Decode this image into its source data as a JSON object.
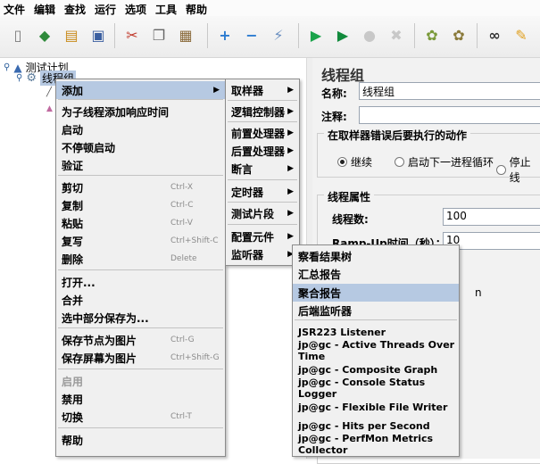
{
  "menubar": [
    "文件",
    "编辑",
    "查找",
    "运行",
    "选项",
    "工具",
    "帮助"
  ],
  "toolbar": {
    "icons": [
      {
        "name": "new-icon",
        "glyph": "▯",
        "color": "#7a7a7a"
      },
      {
        "name": "templates-icon",
        "glyph": "◆",
        "color": "#2f8a3b"
      },
      {
        "name": "open-icon",
        "glyph": "▤",
        "color": "#c88a1a"
      },
      {
        "name": "save-icon",
        "glyph": "▣",
        "color": "#3b5fa0"
      },
      {
        "name": "cut-icon",
        "glyph": "✂",
        "color": "#c0392b"
      },
      {
        "name": "copy-icon",
        "glyph": "❐",
        "color": "#666666"
      },
      {
        "name": "paste-icon",
        "glyph": "▦",
        "color": "#8a6a3a"
      },
      {
        "name": "expand-icon",
        "glyph": "+",
        "color": "#2b7bd0"
      },
      {
        "name": "collapse-icon",
        "glyph": "−",
        "color": "#2b7bd0"
      },
      {
        "name": "toggle-icon",
        "glyph": "⚡",
        "color": "#6a8fc0"
      },
      {
        "name": "start-icon",
        "glyph": "▶",
        "color": "#1aa34a"
      },
      {
        "name": "start-no-pauses-icon",
        "glyph": "▶",
        "color": "#118a3c"
      },
      {
        "name": "stop-icon",
        "glyph": "●",
        "color": "#c8c8c8"
      },
      {
        "name": "shutdown-icon",
        "glyph": "✖",
        "color": "#c8c8c8"
      },
      {
        "name": "clear-icon",
        "glyph": "✿",
        "color": "#7a9a3a"
      },
      {
        "name": "clear-all-icon",
        "glyph": "✿",
        "color": "#8a7a3a"
      },
      {
        "name": "search-icon",
        "glyph": "∞",
        "color": "#333333"
      },
      {
        "name": "reset-search-icon",
        "glyph": "✎",
        "color": "#e0a020"
      }
    ]
  },
  "tree": {
    "root": "测试计划",
    "thread_group": "线程组"
  },
  "panel": {
    "title": "线程组",
    "name_label": "名称:",
    "name_value": "线程组",
    "comment_label": "注释:",
    "comment_value": "",
    "error_group_title": "在取样器错误后要执行的动作",
    "radio_continue": "继续",
    "radio_next_loop": "启动下一进程循环",
    "radio_stop": "停止线",
    "thread_props_title": "线程属性",
    "threads_label": "线程数:",
    "threads_value": "100",
    "rampup_label": "Ramp-Up时间（秒）：",
    "rampup_value": "10",
    "partial_text": "n"
  },
  "context_menu": {
    "items": [
      {
        "label": "添加",
        "shortcut": "",
        "submenu": true,
        "highlight": true
      },
      {
        "label": "为子线程添加响应时间",
        "shortcut": ""
      },
      {
        "label": "启动",
        "shortcut": ""
      },
      {
        "label": "不停顿启动",
        "shortcut": ""
      },
      {
        "label": "验证",
        "shortcut": ""
      },
      {
        "label": "剪切",
        "shortcut": "Ctrl-X"
      },
      {
        "label": "复制",
        "shortcut": "Ctrl-C"
      },
      {
        "label": "粘贴",
        "shortcut": "Ctrl-V"
      },
      {
        "label": "复写",
        "shortcut": "Ctrl+Shift-C"
      },
      {
        "label": "删除",
        "shortcut": "Delete"
      },
      {
        "label": "打开...",
        "shortcut": ""
      },
      {
        "label": "合并",
        "shortcut": ""
      },
      {
        "label": "选中部分保存为...",
        "shortcut": ""
      },
      {
        "label": "保存节点为图片",
        "shortcut": "Ctrl-G"
      },
      {
        "label": "保存屏幕为图片",
        "shortcut": "Ctrl+Shift-G"
      },
      {
        "label": "启用",
        "shortcut": "",
        "disabled": true
      },
      {
        "label": "禁用",
        "shortcut": ""
      },
      {
        "label": "切换",
        "shortcut": "Ctrl-T"
      },
      {
        "label": "帮助",
        "shortcut": ""
      }
    ]
  },
  "add_submenu": {
    "items": [
      "取样器",
      "逻辑控制器",
      "前置处理器",
      "后置处理器",
      "断言",
      "定时器",
      "测试片段",
      "配置元件",
      "监听器"
    ]
  },
  "listener_submenu": {
    "items": [
      "察看结果树",
      "汇总报告",
      "聚合报告",
      "后端监听器",
      "JSR223 Listener",
      "jp@gc - Active Threads Over Time",
      "jp@gc - Composite Graph",
      "jp@gc - Console Status Logger",
      "jp@gc - Flexible File Writer",
      "jp@gc - Hits per Second",
      "jp@gc - PerfMon Metrics Collector"
    ]
  },
  "colors": {
    "menu_highlight": "#b6c9e2",
    "menu_bg": "#f0f0f0"
  }
}
